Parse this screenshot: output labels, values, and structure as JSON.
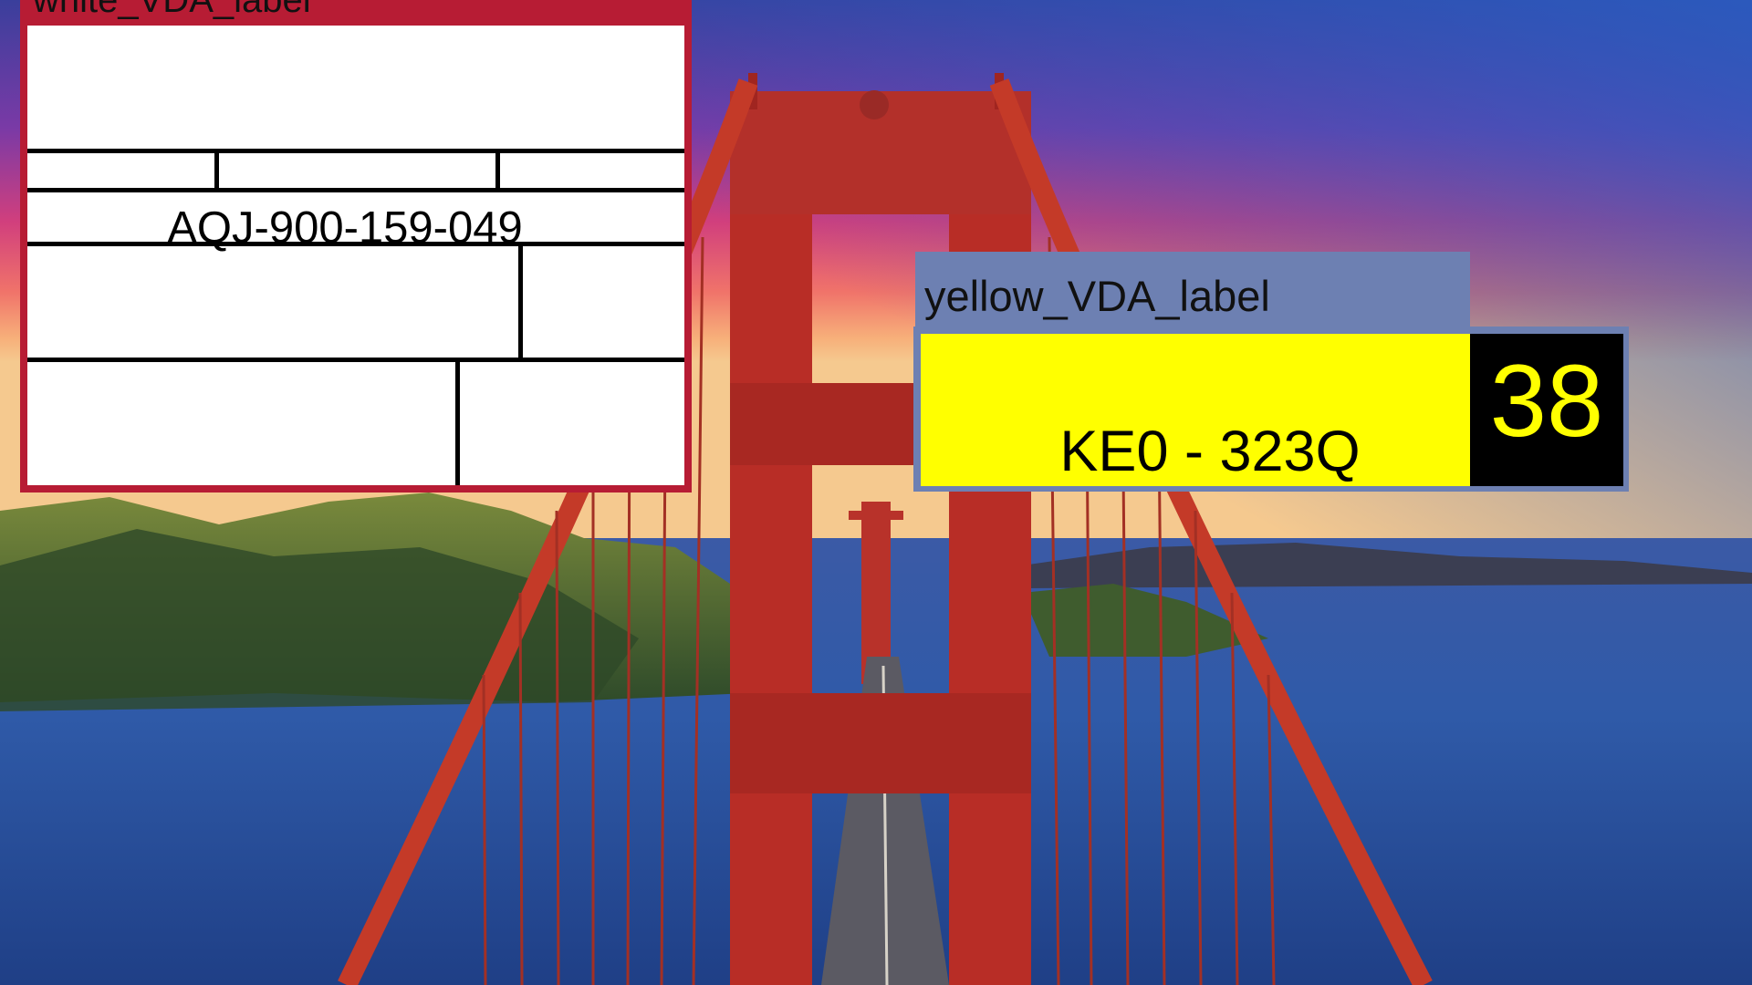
{
  "white_label": {
    "title": "white_VDA_label",
    "part_number": "AQJ-900-159-049"
  },
  "yellow_label": {
    "title": "yellow_VDA_label",
    "plate_number": "KE0 - 323Q",
    "number": "38"
  },
  "colors": {
    "white_frame": "#b71c34",
    "yellow_frame": "#6d80b2",
    "plate": "#ffff00",
    "number_box": "#000000"
  }
}
